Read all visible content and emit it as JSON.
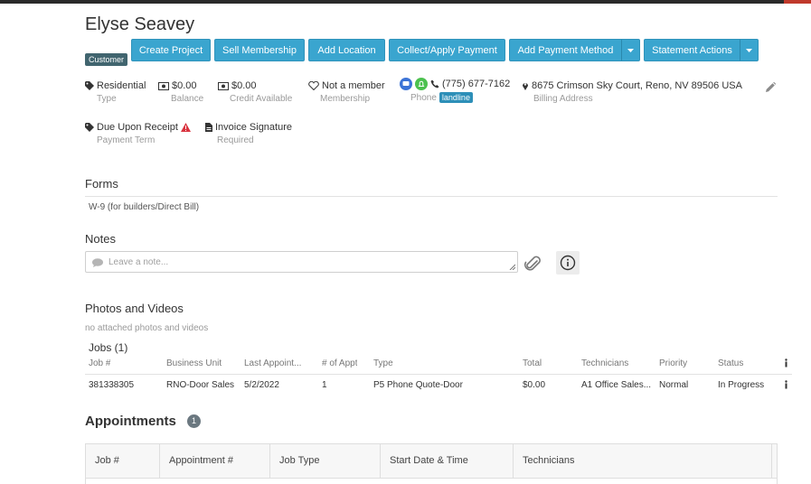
{
  "customer": {
    "name": "Elyse Seavey",
    "tag": "Customer"
  },
  "actions": {
    "create_project": "Create Project",
    "sell_membership": "Sell Membership",
    "add_location": "Add Location",
    "collect_payment": "Collect/Apply Payment",
    "add_payment_method": "Add Payment Method",
    "statement_actions": "Statement Actions"
  },
  "details": {
    "type": {
      "value": "Residential",
      "label": "Type"
    },
    "balance": {
      "value": "$0.00",
      "label": "Balance"
    },
    "credit": {
      "value": "$0.00",
      "label": "Credit Available"
    },
    "membership": {
      "value": "Not a member",
      "label": "Membership"
    },
    "phone": {
      "value": "(775) 677-7162",
      "label": "Phone",
      "badge": "landline"
    },
    "address": {
      "value": "8675 Crimson Sky Court, Reno, NV 89506 USA",
      "label": "Billing Address"
    },
    "payment_term": {
      "value": "Due Upon Receipt",
      "label": "Payment Term"
    },
    "invoice_signature": {
      "value": "Invoice Signature",
      "label": "Required"
    }
  },
  "forms": {
    "title": "Forms",
    "items": [
      "W-9 (for builders/Direct Bill)"
    ]
  },
  "notes": {
    "title": "Notes",
    "placeholder": "Leave a note..."
  },
  "photos": {
    "title": "Photos and Videos",
    "empty": "no attached photos and videos"
  },
  "jobs": {
    "title": "Jobs (1)",
    "columns": [
      "Job #",
      "Business Unit",
      "Last Appoint...",
      "# of Appt",
      "Type",
      "Total",
      "Technicians",
      "Priority",
      "Status"
    ],
    "rows": [
      [
        "381338305",
        "RNO-Door Sales",
        "5/2/2022",
        "1",
        "P5 Phone Quote-Door",
        "$0.00",
        "A1 Office Sales...",
        "Normal",
        "In Progress"
      ]
    ]
  },
  "appointments": {
    "title": "Appointments",
    "count": "1",
    "columns": [
      "Job #",
      "Appointment #",
      "Job Type",
      "Start Date & Time",
      "Technicians"
    ]
  },
  "colors": {
    "primary_button": "#3aa5cf",
    "customer_tag": "#41656f",
    "landline_badge": "#2d8fb8",
    "warning": "#d9343f"
  }
}
